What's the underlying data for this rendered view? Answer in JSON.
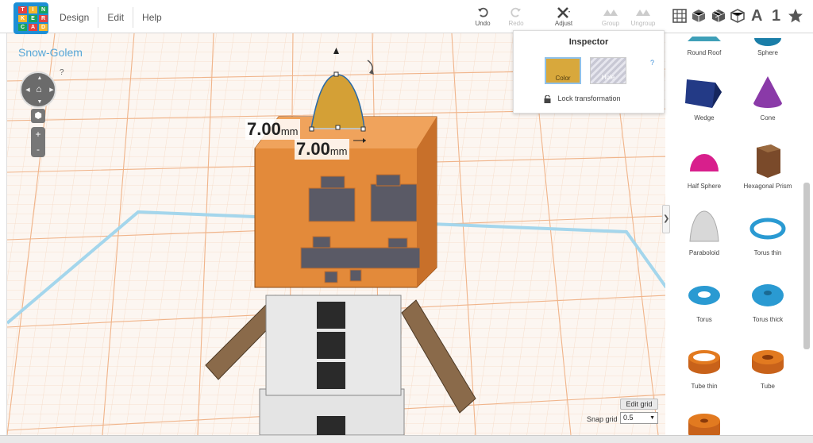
{
  "app": {
    "logo_letters": [
      "T",
      "I",
      "N",
      "K",
      "E",
      "R",
      "C",
      "A",
      "D"
    ],
    "menu": [
      "Design",
      "Edit",
      "Help"
    ],
    "document_title": "Snow-Golem"
  },
  "toolbar": {
    "undo": "Undo",
    "redo": "Redo",
    "adjust": "Adjust",
    "group": "Group",
    "ungroup": "Ungroup"
  },
  "view_icons": [
    "grid-icon",
    "cube-solid-icon",
    "cube-multi-icon",
    "cube-outline-icon",
    "text-icon",
    "number-icon",
    "star-icon"
  ],
  "view_text": {
    "text": "A",
    "number": "1"
  },
  "viewport": {
    "help": "?",
    "zoom_in": "+",
    "zoom_out": "-",
    "dimension_1": {
      "value": "7.00",
      "unit": "mm"
    },
    "dimension_2": {
      "value": "7.00",
      "unit": "mm"
    },
    "edit_grid": "Edit grid",
    "snap_label": "Snap grid",
    "snap_value": "0.5"
  },
  "inspector": {
    "title": "Inspector",
    "help": "?",
    "color_label": "Color",
    "hole_label": "Hole",
    "lock_label": "Lock transformation",
    "selected_color": "#d8a83c"
  },
  "shapes": [
    {
      "label": "Round Roof",
      "icon": "round-roof-icon",
      "color": "#3e9fb8"
    },
    {
      "label": "Sphere",
      "icon": "sphere-icon",
      "color": "#1a7ea8"
    },
    {
      "label": "Wedge",
      "icon": "wedge-icon",
      "color": "#233a86"
    },
    {
      "label": "Cone",
      "icon": "cone-icon",
      "color": "#8a3aa8"
    },
    {
      "label": "Half Sphere",
      "icon": "half-sphere-icon",
      "color": "#d81f8c"
    },
    {
      "label": "Hexagonal Prism",
      "icon": "hexagonal-prism-icon",
      "color": "#7a4a2a"
    },
    {
      "label": "Paraboloid",
      "icon": "paraboloid-icon",
      "color": "#d8d8d8"
    },
    {
      "label": "Torus thin",
      "icon": "torus-thin-icon",
      "color": "#2a9ad2"
    },
    {
      "label": "Torus",
      "icon": "torus-icon",
      "color": "#2a9ad2"
    },
    {
      "label": "Torus thick",
      "icon": "torus-thick-icon",
      "color": "#2a9ad2"
    },
    {
      "label": "Tube thin",
      "icon": "tube-thin-icon",
      "color": "#e27a20"
    },
    {
      "label": "Tube",
      "icon": "tube-icon",
      "color": "#e27a20"
    },
    {
      "label": "",
      "icon": "tube-thick-icon",
      "color": "#e27a20"
    }
  ]
}
